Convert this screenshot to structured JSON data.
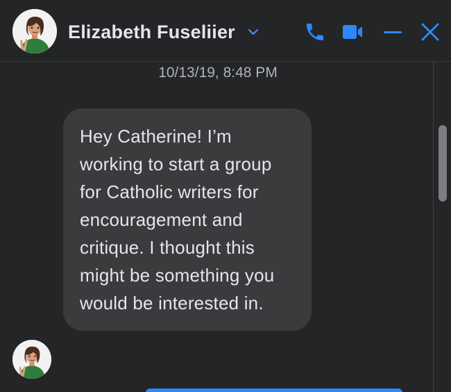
{
  "header": {
    "contact_name": "Elizabeth Fuseliier",
    "icons": [
      "avatar",
      "chevron-down-icon",
      "phone-icon",
      "video-camera-icon",
      "minimize-icon",
      "close-icon"
    ]
  },
  "conversation": {
    "timestamp": "10/13/19, 8:48 PM",
    "messages": [
      {
        "sender": "Elizabeth Fuseliier",
        "text": "Hey Catherine! I’m working to start a group for Catholic writers for encouragement and critique. I thought this might be something you would be interested in."
      }
    ]
  },
  "colors": {
    "background": "#242526",
    "bubble": "#3a3b3c",
    "accent": "#2d88ff",
    "text_primary": "#e4e6eb",
    "text_secondary": "#b0b3b8"
  }
}
